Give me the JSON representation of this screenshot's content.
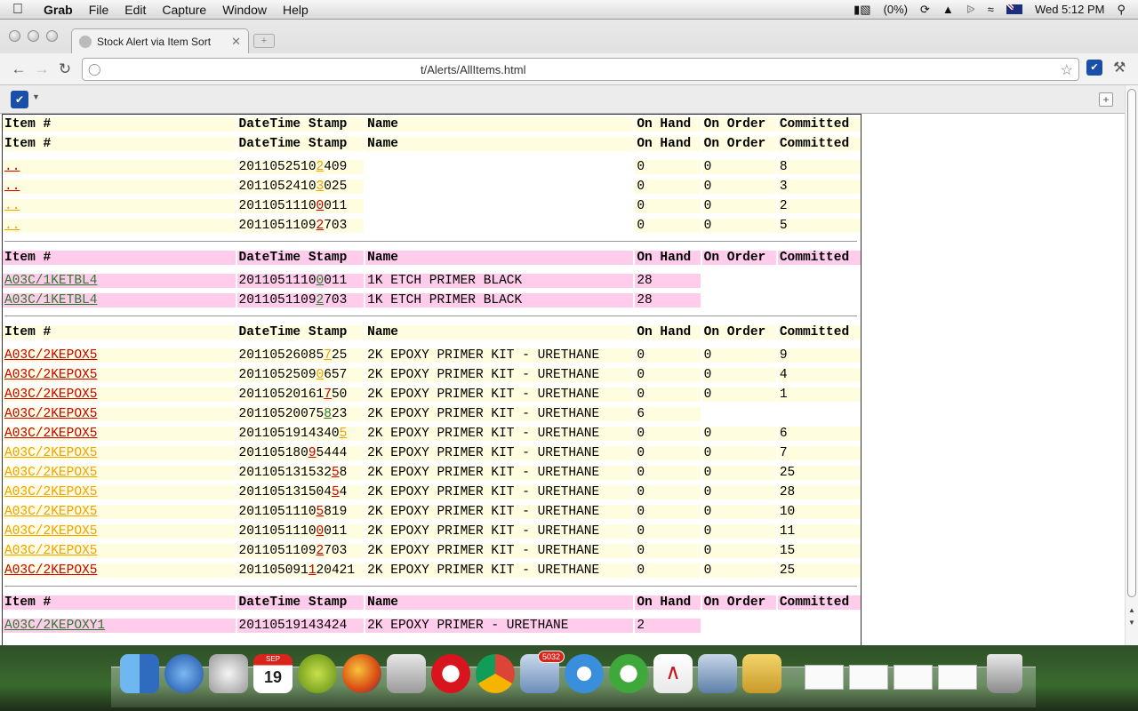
{
  "menubar": {
    "app": "Grab",
    "items": [
      "File",
      "Edit",
      "Capture",
      "Window",
      "Help"
    ],
    "battery": "(0%)",
    "clock": "Wed 5:12 PM"
  },
  "browser": {
    "tab_title": "Stock Alert via Item Sort",
    "url": "t/Alerts/AllItems.html"
  },
  "headers": [
    "Item #",
    "DateTime Stamp",
    "Name",
    "On Hand",
    "On Order",
    "Committed"
  ],
  "groups": [
    {
      "color": "yellow",
      "double_header": true,
      "rows": [
        {
          "item": "..",
          "item_color": "red",
          "stamp": [
            "2011052510",
            "2",
            "409"
          ],
          "digit_color": "orange",
          "name": "",
          "on_hand": "0",
          "on_order": "0",
          "committed": "8"
        },
        {
          "item": "..",
          "item_color": "red",
          "stamp": [
            "2011052410",
            "3",
            "025"
          ],
          "digit_color": "orange",
          "name": "",
          "on_hand": "0",
          "on_order": "0",
          "committed": "3"
        },
        {
          "item": "..",
          "item_color": "orange",
          "stamp": [
            "2011051110",
            "0",
            "011"
          ],
          "digit_color": "red",
          "name": "",
          "on_hand": "0",
          "on_order": "0",
          "committed": "2"
        },
        {
          "item": "..",
          "item_color": "orange",
          "stamp": [
            "2011051109",
            "2",
            "703"
          ],
          "digit_color": "red",
          "name": "",
          "on_hand": "0",
          "on_order": "0",
          "committed": "5"
        }
      ]
    },
    {
      "color": "pink",
      "double_header": false,
      "rows": [
        {
          "item": "A03C/1KETBL4",
          "item_color": "green",
          "stamp": [
            "2011051110",
            "0",
            "011"
          ],
          "digit_color": "green",
          "name": "1K ETCH PRIMER BLACK",
          "on_hand": "28",
          "on_order": "",
          "committed": ""
        },
        {
          "item": "A03C/1KETBL4",
          "item_color": "green",
          "stamp": [
            "2011051109",
            "2",
            "703"
          ],
          "digit_color": "green",
          "name": "1K ETCH PRIMER BLACK",
          "on_hand": "28",
          "on_order": "",
          "committed": ""
        }
      ]
    },
    {
      "color": "yellow",
      "double_header": false,
      "rows": [
        {
          "item": "A03C/2KEPOX5",
          "item_color": "red",
          "stamp": [
            "20110526085",
            "7",
            "25"
          ],
          "digit_color": "orange",
          "name": "2K EPOXY PRIMER KIT - URETHANE",
          "on_hand": "0",
          "on_order": "0",
          "committed": "9"
        },
        {
          "item": "A03C/2KEPOX5",
          "item_color": "red",
          "stamp": [
            "2011052509",
            "0",
            "657"
          ],
          "digit_color": "orange",
          "name": "2K EPOXY PRIMER KIT - URETHANE",
          "on_hand": "0",
          "on_order": "0",
          "committed": "4"
        },
        {
          "item": "A03C/2KEPOX5",
          "item_color": "red",
          "stamp": [
            "20110520161",
            "7",
            "50"
          ],
          "digit_color": "red",
          "name": "2K EPOXY PRIMER KIT - URETHANE",
          "on_hand": "0",
          "on_order": "0",
          "committed": "1"
        },
        {
          "item": "A03C/2KEPOX5",
          "item_color": "red",
          "stamp": [
            "20110520075",
            "8",
            "23"
          ],
          "digit_color": "green",
          "name": "2K EPOXY PRIMER KIT - URETHANE",
          "on_hand": "6",
          "on_order": "",
          "committed": ""
        },
        {
          "item": "A03C/2KEPOX5",
          "item_color": "red",
          "stamp": [
            "2011051914340",
            "5",
            ""
          ],
          "digit_color": "orange",
          "name": "2K EPOXY PRIMER KIT - URETHANE",
          "on_hand": "0",
          "on_order": "0",
          "committed": "6"
        },
        {
          "item": "A03C/2KEPOX5",
          "item_color": "orange",
          "stamp": [
            "201105180",
            "9",
            "5444"
          ],
          "digit_color": "red",
          "name": "2K EPOXY PRIMER KIT - URETHANE",
          "on_hand": "0",
          "on_order": "0",
          "committed": "7"
        },
        {
          "item": "A03C/2KEPOX5",
          "item_color": "orange",
          "stamp": [
            "201105131532",
            "5",
            "8"
          ],
          "digit_color": "red",
          "name": "2K EPOXY PRIMER KIT - URETHANE",
          "on_hand": "0",
          "on_order": "0",
          "committed": "25"
        },
        {
          "item": "A03C/2KEPOX5",
          "item_color": "orange",
          "stamp": [
            "201105131504",
            "5",
            "4"
          ],
          "digit_color": "red",
          "name": "2K EPOXY PRIMER KIT - URETHANE",
          "on_hand": "0",
          "on_order": "0",
          "committed": "28"
        },
        {
          "item": "A03C/2KEPOX5",
          "item_color": "orange",
          "stamp": [
            "2011051110",
            "5",
            "819"
          ],
          "digit_color": "red",
          "name": "2K EPOXY PRIMER KIT - URETHANE",
          "on_hand": "0",
          "on_order": "0",
          "committed": "10"
        },
        {
          "item": "A03C/2KEPOX5",
          "item_color": "orange",
          "stamp": [
            "2011051110",
            "0",
            "011"
          ],
          "digit_color": "red",
          "name": "2K EPOXY PRIMER KIT - URETHANE",
          "on_hand": "0",
          "on_order": "0",
          "committed": "11"
        },
        {
          "item": "A03C/2KEPOX5",
          "item_color": "orange",
          "stamp": [
            "2011051109",
            "2",
            "703"
          ],
          "digit_color": "red",
          "name": "2K EPOXY PRIMER KIT - URETHANE",
          "on_hand": "0",
          "on_order": "0",
          "committed": "15"
        },
        {
          "item": "A03C/2KEPOX5",
          "item_color": "red",
          "stamp": [
            "201105091",
            "1",
            "20421"
          ],
          "digit_color": "red",
          "name": "2K EPOXY PRIMER KIT - URETHANE",
          "on_hand": "0",
          "on_order": "0",
          "committed": "25"
        }
      ]
    },
    {
      "color": "pink",
      "double_header": false,
      "rows": [
        {
          "item": "A03C/2KEPOXY1",
          "item_color": "green",
          "stamp": [
            "20110519143424",
            "",
            ""
          ],
          "digit_color": "green",
          "name": "2K EPOXY PRIMER - URETHANE",
          "on_hand": "2",
          "on_order": "",
          "committed": ""
        }
      ]
    }
  ],
  "colors": {
    "red": "#cc0000",
    "orange": "#f2a100",
    "green": "#2d7a2d",
    "yellow_bg": "#fffde0",
    "pink_bg": "#ffcceb"
  },
  "dock": {
    "calendar_month": "SEP",
    "calendar_day": "19",
    "mail_badge": "5032",
    "icons": [
      "finder-icon",
      "itunes-icon",
      "evernote-icon",
      "calendar-icon",
      "vnc-viewer-icon",
      "firefox-icon",
      "scissors-icon",
      "opera-icon",
      "chrome-icon",
      "mail-icon",
      "safari-icon",
      "utorrent-icon",
      "acrobat-icon",
      "preview-icon",
      "paint-icon"
    ]
  }
}
